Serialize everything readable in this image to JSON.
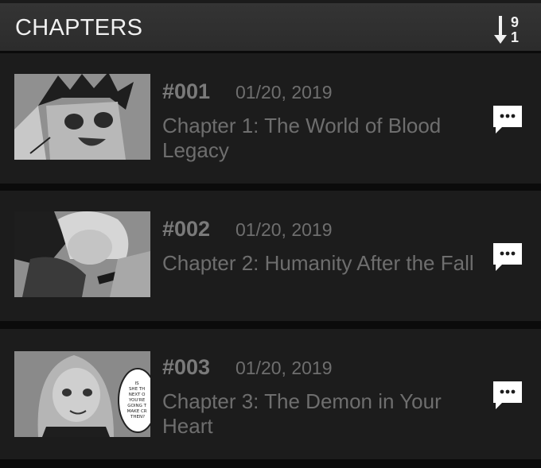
{
  "header": {
    "title": "CHAPTERS",
    "sort_icon": "sort-descending-9-1-icon",
    "sort_top": "9",
    "sort_bottom": "1"
  },
  "chapters": [
    {
      "number": "#001",
      "date": "01/20, 2019",
      "title": "Chapter 1:  The World of Blood Legacy",
      "comment_icon": "comment-icon"
    },
    {
      "number": "#002",
      "date": "01/20, 2019",
      "title": "Chapter 2:  Humanity After the Fall",
      "comment_icon": "comment-icon"
    },
    {
      "number": "#003",
      "date": "01/20, 2019",
      "title": "Chapter 3:  The Demon in Your Heart",
      "comment_icon": "comment-icon"
    }
  ],
  "thumb3_bubble": [
    "IS",
    "SHE TH",
    "NEXT O",
    "YOU'RE",
    "GOING T",
    "MAKE CR",
    "THEN?"
  ],
  "colors": {
    "header_bg": "#303030",
    "row_bg": "#1c1c1c",
    "separator": "#0b0b0b",
    "text_muted": "#6e6e6e",
    "text_header": "#f0f0f0"
  }
}
